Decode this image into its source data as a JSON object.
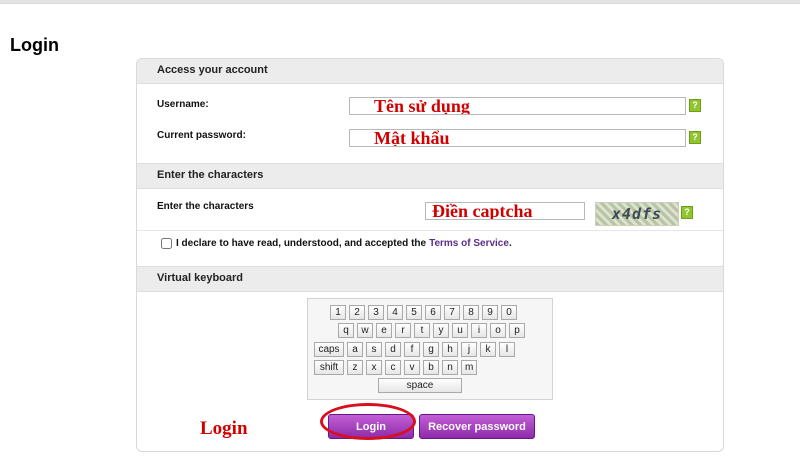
{
  "page": {
    "title": "Login"
  },
  "account": {
    "header": "Access your account",
    "username_label": "Username:",
    "username_placeholder": "Tên sử dụng",
    "password_label": "Current password:",
    "password_placeholder": "Mật khẩu",
    "help_glyph": "?"
  },
  "captcha": {
    "header": "Enter the characters",
    "label": "Enter the characters",
    "input_placeholder": "Điền captcha",
    "image_text": "x4dfs",
    "help_glyph": "?"
  },
  "terms": {
    "text": "I declare to have read, understood, and accepted the",
    "link": "Terms of Service",
    "suffix": "."
  },
  "keyboard": {
    "header": "Virtual keyboard",
    "rows": [
      [
        "1",
        "2",
        "3",
        "4",
        "5",
        "6",
        "7",
        "8",
        "9",
        "0"
      ],
      [
        "q",
        "w",
        "e",
        "r",
        "t",
        "y",
        "u",
        "i",
        "o",
        "p"
      ],
      [
        "caps",
        "a",
        "s",
        "d",
        "f",
        "g",
        "h",
        "j",
        "k",
        "l"
      ],
      [
        "shift",
        "z",
        "x",
        "c",
        "v",
        "b",
        "n",
        "m"
      ],
      [
        "space"
      ]
    ]
  },
  "actions": {
    "login_label": "Login",
    "recover_label": "Recover password"
  },
  "annotations": {
    "login_note": "Login"
  },
  "colors": {
    "accent_purple": "#8e2ba9",
    "annotation_red": "#d10000",
    "help_green": "#8ec62b"
  }
}
